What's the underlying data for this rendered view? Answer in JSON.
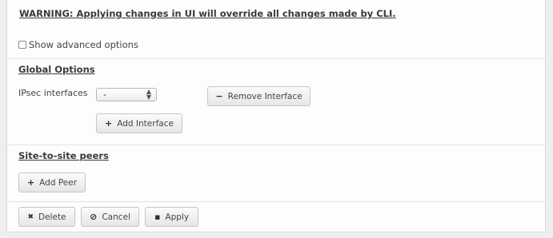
{
  "warning": "WARNING: Applying changes in UI will override all changes made by CLI.",
  "advanced": {
    "label": "Show advanced options",
    "checked": false
  },
  "global_options": {
    "title": "Global Options",
    "ipsec_label": "IPsec interfaces",
    "ipsec_value": "-",
    "remove_icon": "−",
    "remove_label": "Remove Interface",
    "add_icon": "+",
    "add_label": "Add Interface"
  },
  "peers": {
    "title": "Site-to-site peers",
    "add_icon": "+",
    "add_label": "Add Peer"
  },
  "footer": {
    "delete_icon": "✖",
    "delete_label": "Delete",
    "cancel_icon": "⊘",
    "cancel_label": "Cancel",
    "apply_icon": "▪",
    "apply_label": "Apply"
  }
}
